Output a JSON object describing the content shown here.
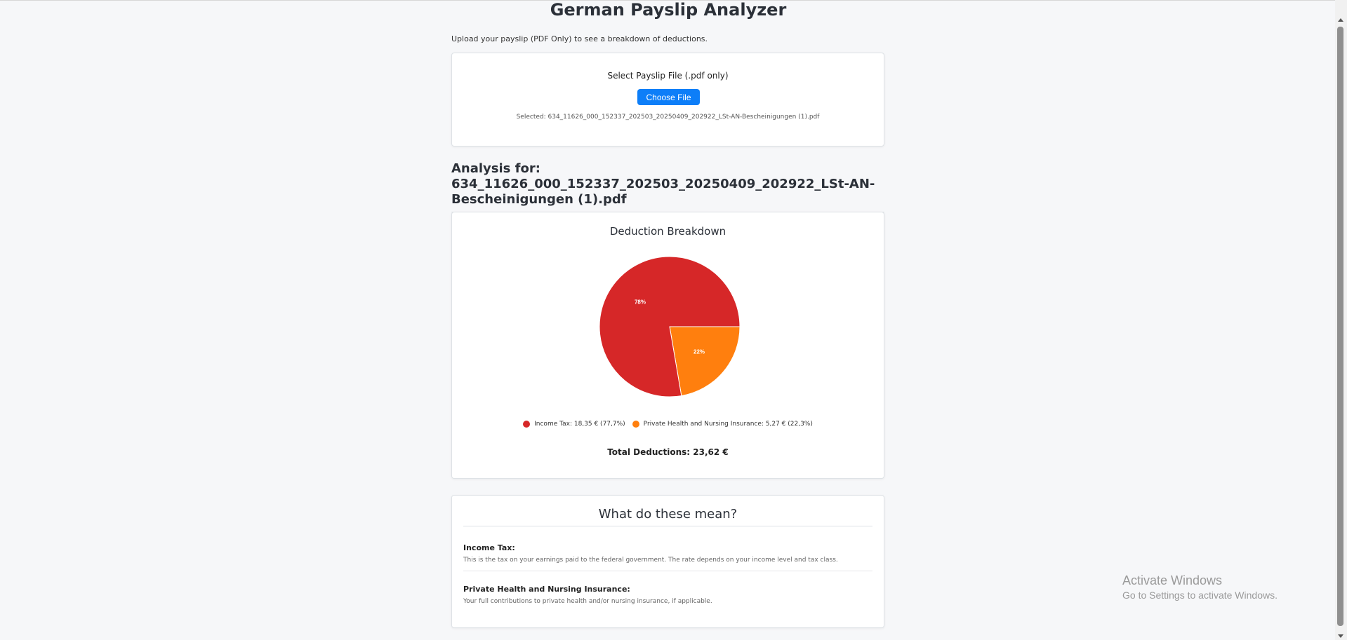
{
  "app": {
    "title": "German Payslip Analyzer",
    "intro": "Upload your payslip (PDF Only) to see a breakdown of deductions."
  },
  "upload": {
    "label": "Select Payslip File (.pdf only)",
    "button_label": "Choose File",
    "selected_text": "Selected: 634_11626_000_152337_202503_20250409_202922_LSt-AN-Bescheinigungen (1).pdf"
  },
  "analysis": {
    "heading": "Analysis for: 634_11626_000_152337_202503_20250409_202922_LSt-AN-Bescheinigungen (1).pdf"
  },
  "chart_data": {
    "type": "pie",
    "title": "Deduction Breakdown",
    "slices": [
      {
        "label": "Income Tax",
        "value": 18.35,
        "display": "Income Tax: 18,35 € (77,7%)",
        "percent_label": "78%",
        "color": "#d62728"
      },
      {
        "label": "Private Health and Nursing Insurance",
        "value": 5.27,
        "display": "Private Health and Nursing Insurance: 5,27 € (22,3%)",
        "percent_label": "22%",
        "color": "#ff7f0e"
      }
    ],
    "legend_position": "bottom"
  },
  "total": {
    "text": "Total Deductions: 23,62 €"
  },
  "meanings": {
    "title": "What do these mean?",
    "items": [
      {
        "name": "Income Tax:",
        "description": "This is the tax on your earnings paid to the federal government. The rate depends on your income level and tax class."
      },
      {
        "name": "Private Health and Nursing Insurance:",
        "description": "Your full contributions to private health and/or nursing insurance, if applicable."
      }
    ]
  },
  "os_watermark": {
    "title": "Activate Windows",
    "subtitle": "Go to Settings to activate Windows."
  }
}
